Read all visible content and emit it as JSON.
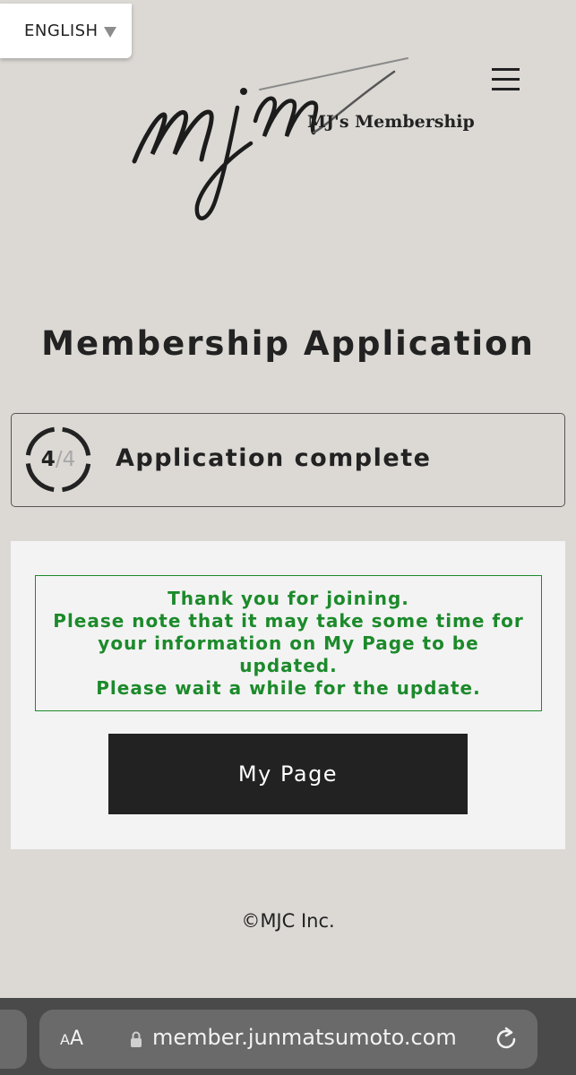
{
  "language": {
    "selected": "ENGLISH",
    "caret_icon": "caret-down-icon"
  },
  "header": {
    "logo_script": "mjm",
    "logo_subtitle": "MJ's Membership",
    "menu_icon": "hamburger-menu-icon"
  },
  "page": {
    "title": "Membership Application"
  },
  "step": {
    "current": "4",
    "separator": "/",
    "total": "4",
    "label": "Application complete"
  },
  "notice": {
    "lines": [
      "Thank you for joining.",
      "Please note that it may take some time for",
      "your information on My Page to be",
      "updated.",
      "Please wait a while for the update."
    ],
    "color": "#1c8a2b"
  },
  "actions": {
    "my_page_label": "My Page"
  },
  "footer": {
    "copyright": "©MJC Inc."
  },
  "browser": {
    "text_size_label": "AA",
    "url": "member.junmatsumoto.com",
    "lock_icon": "lock-icon",
    "reload_icon": "reload-icon"
  }
}
